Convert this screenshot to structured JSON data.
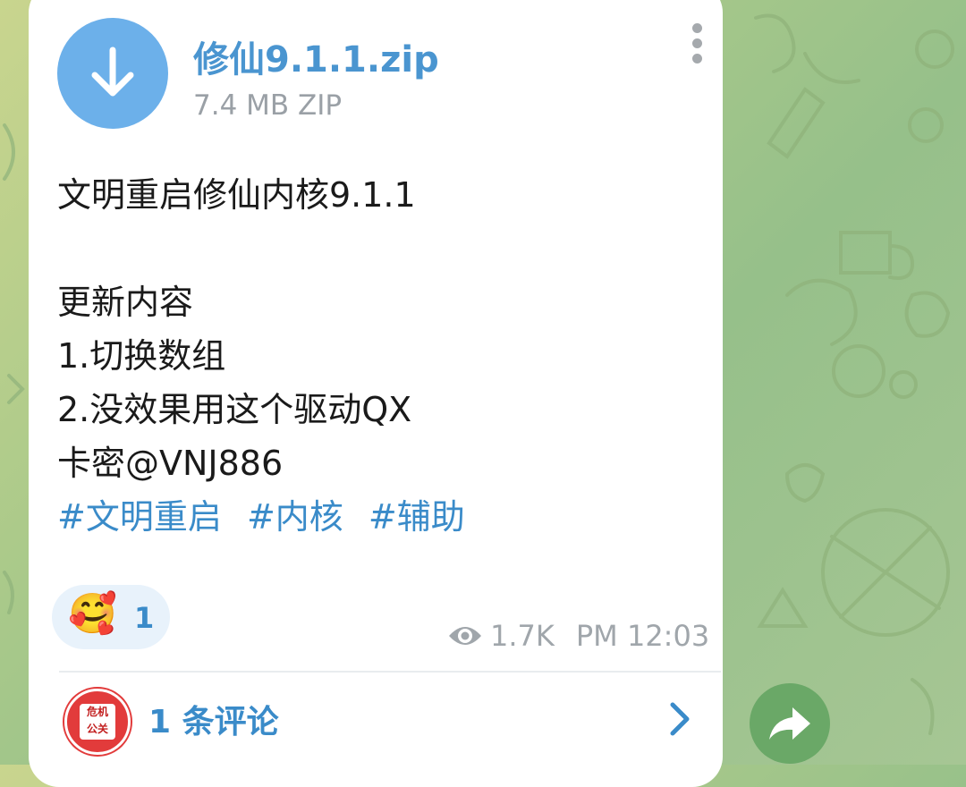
{
  "file": {
    "name": "修仙9.1.1.zip",
    "meta": "7.4 MB ZIP",
    "icon": "download-icon"
  },
  "message": {
    "lines": [
      "文明重启修仙内核9.1.1",
      "",
      "更新内容",
      "1.切换数组",
      "2.没效果用这个驱动QX",
      "卡密@VNJ886"
    ],
    "hashtags": [
      "#文明重启",
      "#内核",
      "#辅助"
    ]
  },
  "reaction": {
    "emoji": "🥰",
    "count": "1"
  },
  "stats": {
    "views": "1.7K",
    "time": "PM 12:03"
  },
  "comments": {
    "label": "1 条评论",
    "avatar_text": [
      "危机",
      "公关"
    ]
  },
  "colors": {
    "accent": "#3a8bc9",
    "file_button": "#6cb0ea",
    "share_button": "#6aa867",
    "reaction_bg": "#e8f2fb"
  }
}
